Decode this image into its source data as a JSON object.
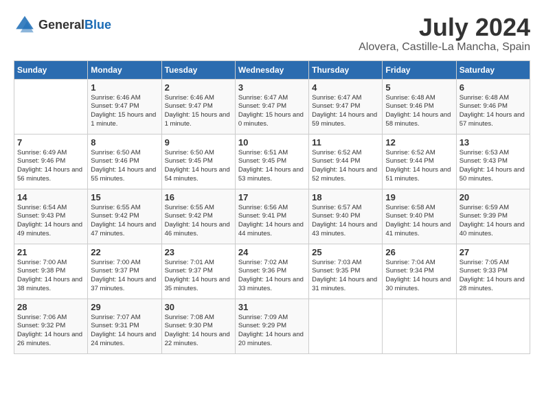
{
  "header": {
    "logo_general": "General",
    "logo_blue": "Blue",
    "month": "July 2024",
    "location": "Alovera, Castille-La Mancha, Spain"
  },
  "days_of_week": [
    "Sunday",
    "Monday",
    "Tuesday",
    "Wednesday",
    "Thursday",
    "Friday",
    "Saturday"
  ],
  "weeks": [
    [
      {
        "day": "",
        "info": ""
      },
      {
        "day": "1",
        "info": "Sunrise: 6:46 AM\nSunset: 9:47 PM\nDaylight: 15 hours\nand 1 minute."
      },
      {
        "day": "2",
        "info": "Sunrise: 6:46 AM\nSunset: 9:47 PM\nDaylight: 15 hours\nand 1 minute."
      },
      {
        "day": "3",
        "info": "Sunrise: 6:47 AM\nSunset: 9:47 PM\nDaylight: 15 hours\nand 0 minutes."
      },
      {
        "day": "4",
        "info": "Sunrise: 6:47 AM\nSunset: 9:47 PM\nDaylight: 14 hours\nand 59 minutes."
      },
      {
        "day": "5",
        "info": "Sunrise: 6:48 AM\nSunset: 9:46 PM\nDaylight: 14 hours\nand 58 minutes."
      },
      {
        "day": "6",
        "info": "Sunrise: 6:48 AM\nSunset: 9:46 PM\nDaylight: 14 hours\nand 57 minutes."
      }
    ],
    [
      {
        "day": "7",
        "info": "Sunrise: 6:49 AM\nSunset: 9:46 PM\nDaylight: 14 hours\nand 56 minutes."
      },
      {
        "day": "8",
        "info": "Sunrise: 6:50 AM\nSunset: 9:46 PM\nDaylight: 14 hours\nand 55 minutes."
      },
      {
        "day": "9",
        "info": "Sunrise: 6:50 AM\nSunset: 9:45 PM\nDaylight: 14 hours\nand 54 minutes."
      },
      {
        "day": "10",
        "info": "Sunrise: 6:51 AM\nSunset: 9:45 PM\nDaylight: 14 hours\nand 53 minutes."
      },
      {
        "day": "11",
        "info": "Sunrise: 6:52 AM\nSunset: 9:44 PM\nDaylight: 14 hours\nand 52 minutes."
      },
      {
        "day": "12",
        "info": "Sunrise: 6:52 AM\nSunset: 9:44 PM\nDaylight: 14 hours\nand 51 minutes."
      },
      {
        "day": "13",
        "info": "Sunrise: 6:53 AM\nSunset: 9:43 PM\nDaylight: 14 hours\nand 50 minutes."
      }
    ],
    [
      {
        "day": "14",
        "info": "Sunrise: 6:54 AM\nSunset: 9:43 PM\nDaylight: 14 hours\nand 49 minutes."
      },
      {
        "day": "15",
        "info": "Sunrise: 6:55 AM\nSunset: 9:42 PM\nDaylight: 14 hours\nand 47 minutes."
      },
      {
        "day": "16",
        "info": "Sunrise: 6:55 AM\nSunset: 9:42 PM\nDaylight: 14 hours\nand 46 minutes."
      },
      {
        "day": "17",
        "info": "Sunrise: 6:56 AM\nSunset: 9:41 PM\nDaylight: 14 hours\nand 44 minutes."
      },
      {
        "day": "18",
        "info": "Sunrise: 6:57 AM\nSunset: 9:40 PM\nDaylight: 14 hours\nand 43 minutes."
      },
      {
        "day": "19",
        "info": "Sunrise: 6:58 AM\nSunset: 9:40 PM\nDaylight: 14 hours\nand 41 minutes."
      },
      {
        "day": "20",
        "info": "Sunrise: 6:59 AM\nSunset: 9:39 PM\nDaylight: 14 hours\nand 40 minutes."
      }
    ],
    [
      {
        "day": "21",
        "info": "Sunrise: 7:00 AM\nSunset: 9:38 PM\nDaylight: 14 hours\nand 38 minutes."
      },
      {
        "day": "22",
        "info": "Sunrise: 7:00 AM\nSunset: 9:37 PM\nDaylight: 14 hours\nand 37 minutes."
      },
      {
        "day": "23",
        "info": "Sunrise: 7:01 AM\nSunset: 9:37 PM\nDaylight: 14 hours\nand 35 minutes."
      },
      {
        "day": "24",
        "info": "Sunrise: 7:02 AM\nSunset: 9:36 PM\nDaylight: 14 hours\nand 33 minutes."
      },
      {
        "day": "25",
        "info": "Sunrise: 7:03 AM\nSunset: 9:35 PM\nDaylight: 14 hours\nand 31 minutes."
      },
      {
        "day": "26",
        "info": "Sunrise: 7:04 AM\nSunset: 9:34 PM\nDaylight: 14 hours\nand 30 minutes."
      },
      {
        "day": "27",
        "info": "Sunrise: 7:05 AM\nSunset: 9:33 PM\nDaylight: 14 hours\nand 28 minutes."
      }
    ],
    [
      {
        "day": "28",
        "info": "Sunrise: 7:06 AM\nSunset: 9:32 PM\nDaylight: 14 hours\nand 26 minutes."
      },
      {
        "day": "29",
        "info": "Sunrise: 7:07 AM\nSunset: 9:31 PM\nDaylight: 14 hours\nand 24 minutes."
      },
      {
        "day": "30",
        "info": "Sunrise: 7:08 AM\nSunset: 9:30 PM\nDaylight: 14 hours\nand 22 minutes."
      },
      {
        "day": "31",
        "info": "Sunrise: 7:09 AM\nSunset: 9:29 PM\nDaylight: 14 hours\nand 20 minutes."
      },
      {
        "day": "",
        "info": ""
      },
      {
        "day": "",
        "info": ""
      },
      {
        "day": "",
        "info": ""
      }
    ]
  ]
}
